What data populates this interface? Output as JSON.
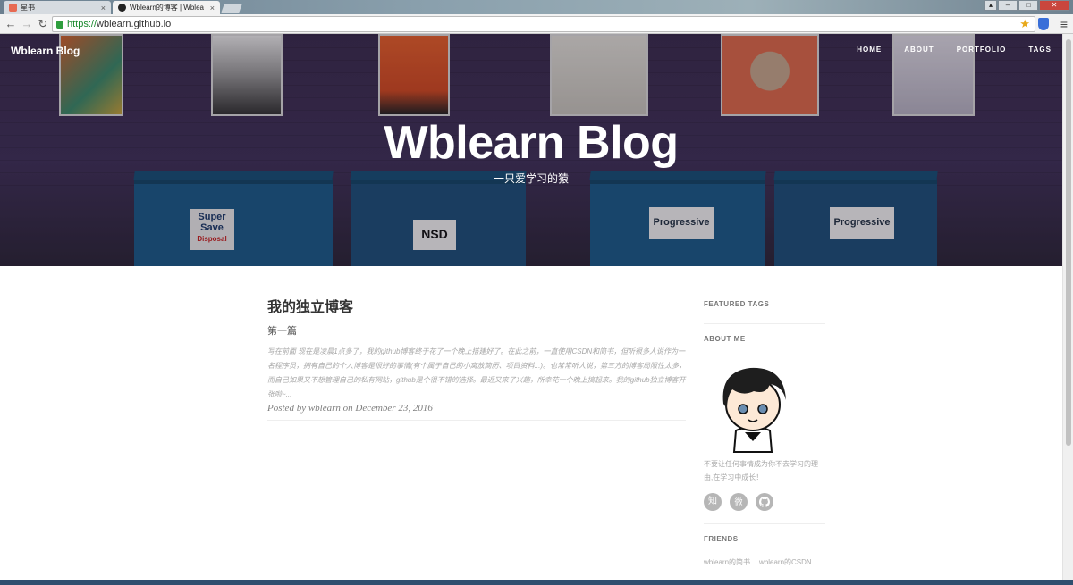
{
  "browser": {
    "tabs": [
      {
        "label": "星书",
        "active": false
      },
      {
        "label": "Wblearn的博客 | Wblea",
        "active": true
      }
    ],
    "url_scheme": "https://",
    "url_host": "wblearn.github.io",
    "colors": {
      "secure": "#1b8a2e"
    }
  },
  "site": {
    "brand": "Wblearn Blog",
    "nav": [
      "HOME",
      "ABOUT",
      "PORTFOLIO",
      "TAGS"
    ],
    "hero_title": "Wblearn Blog",
    "hero_subtitle": "一只爱学习的猿"
  },
  "post": {
    "title": "我的独立博客",
    "subtitle": "第一篇",
    "excerpt": "写在前面 现在是凌晨1点多了，我的github博客终于花了一个晚上搭建好了。在此之前，一直使用CSDN和简书，但听很多人说作为一名程序员，拥有自己的个人博客是很好的事情(有个属于自己的小窝放简历、项目资料...)。也常常听人说，第三方的博客局限性太多，而自己如果又不想管理自己的私有网站，github是个很不错的选择。最近又来了兴趣，所幸花一个晚上搞起来。我的github独立博客开张啦~...",
    "meta": "Posted by wblearn on December 23, 2016"
  },
  "sidebar": {
    "featured_tags": "FEATURED TAGS",
    "about_me": "ABOUT ME",
    "about_text": "不要让任何事情成为你不去学习的理由,在学习中成长！",
    "social": [
      "知",
      "微",
      "git"
    ],
    "friends_heading": "FRIENDS",
    "friends": [
      "wblearn的简书",
      "wblearn的CSDN"
    ]
  }
}
